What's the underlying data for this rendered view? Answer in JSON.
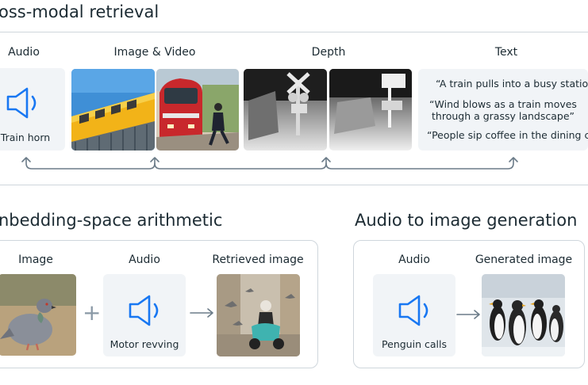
{
  "sections": {
    "retrieval_title": "oss-modal retrieval",
    "arithmetic_title": "nbedding-space arithmetic",
    "generation_title": "Audio to image generation"
  },
  "retrieval": {
    "labels": {
      "audio": "Audio",
      "image_video": "Image & Video",
      "depth": "Depth",
      "text": "Text"
    },
    "audio_caption": "Train horn",
    "quotes": [
      "“A train pulls into a busy station”",
      "“Wind blows as a train moves",
      "through a grassy landscape”",
      "“People sip coffee in the dining ca"
    ]
  },
  "arithmetic": {
    "labels": {
      "image": "Image",
      "audio": "Audio",
      "retrieved": "Retrieved image"
    },
    "audio_caption": "Motor revving",
    "plus": "+"
  },
  "generation": {
    "labels": {
      "audio": "Audio",
      "generated": "Generated image"
    },
    "audio_caption": "Penguin calls"
  },
  "colors": {
    "accent_icon": "#1877f2",
    "arrow": "#6b7b88",
    "card_bg": "#f1f4f7",
    "border": "#cfd6dc"
  }
}
